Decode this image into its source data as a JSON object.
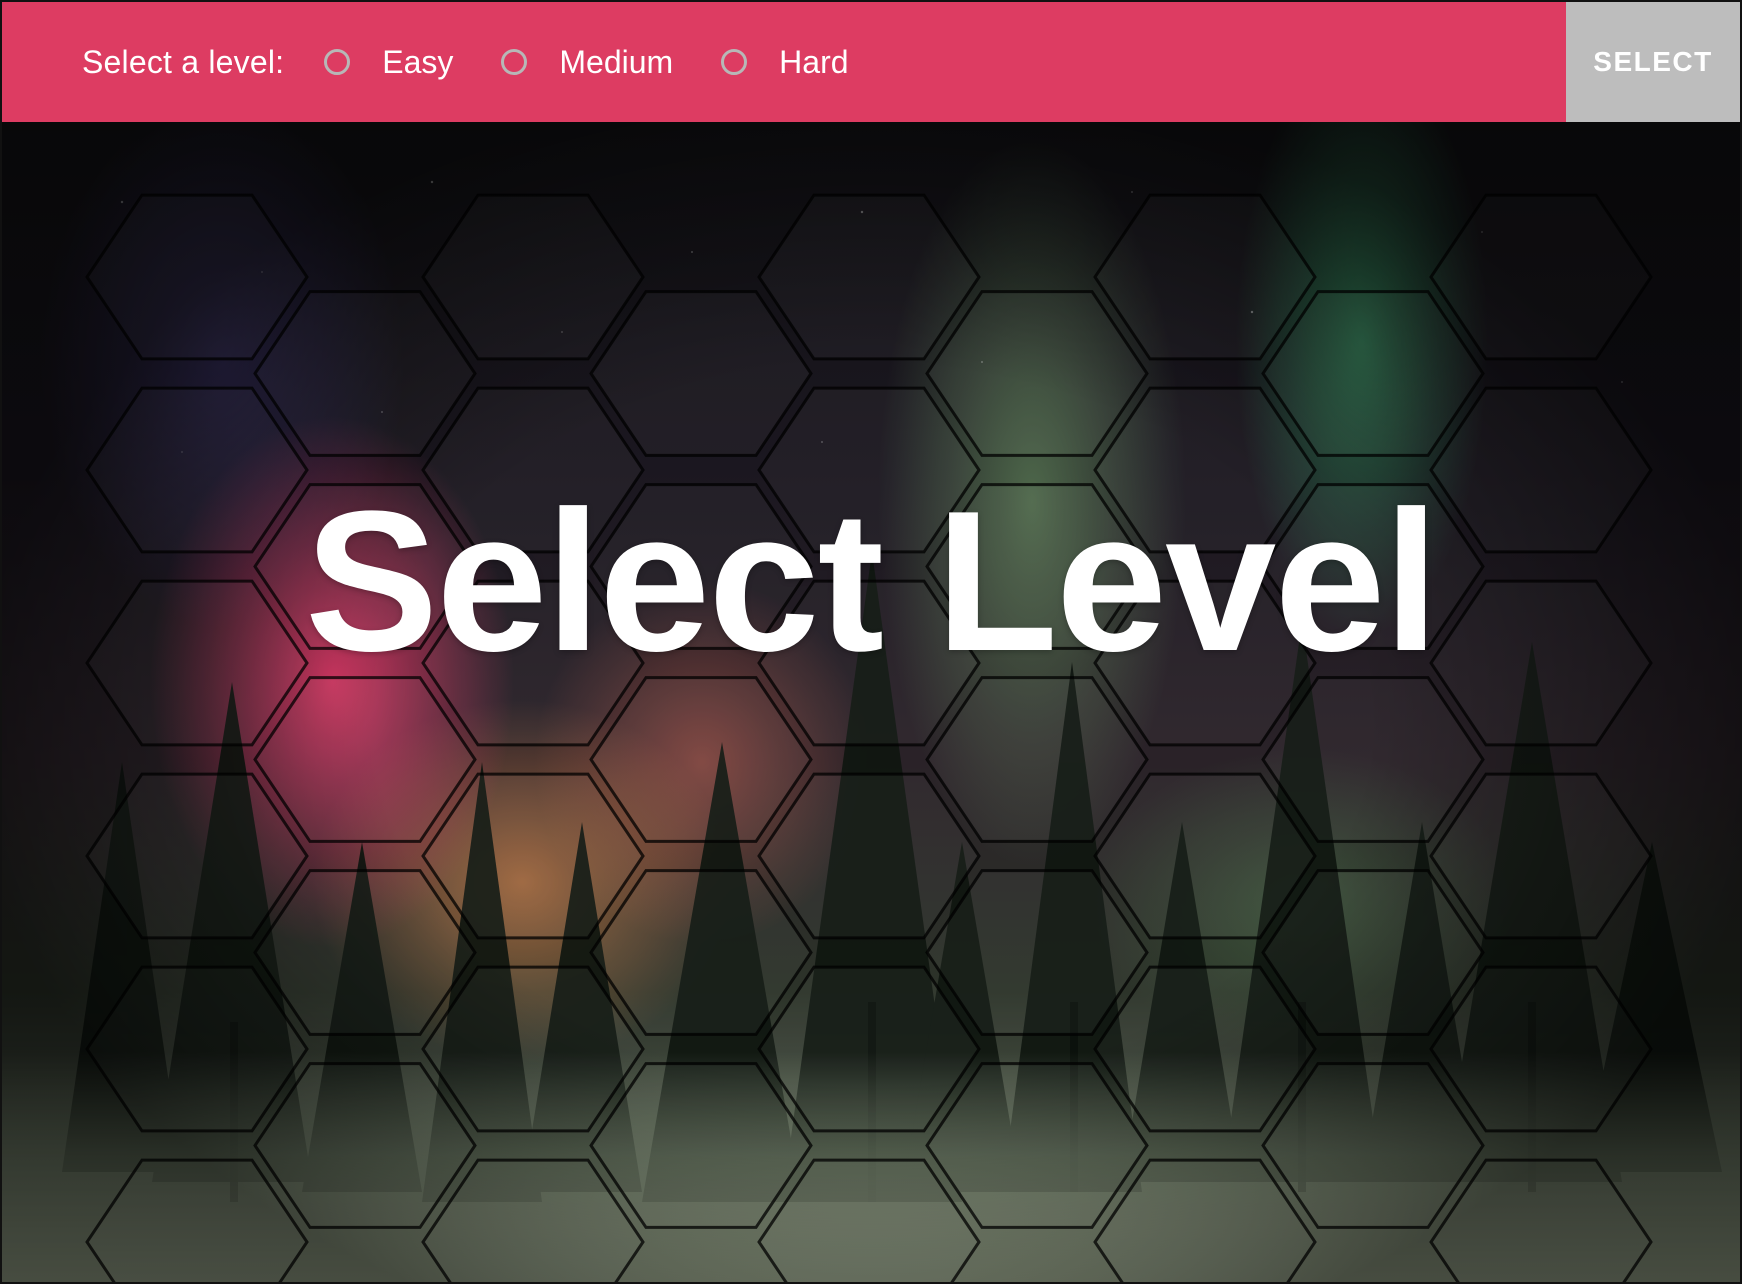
{
  "header": {
    "prompt_label": "Select a level:",
    "levels": [
      {
        "label": "Easy"
      },
      {
        "label": "Medium"
      },
      {
        "label": "Hard"
      }
    ],
    "select_button": "SELECT",
    "bar_color": "#dd3c62",
    "button_color": "#bdbdbd"
  },
  "main": {
    "title": "Select Level"
  }
}
